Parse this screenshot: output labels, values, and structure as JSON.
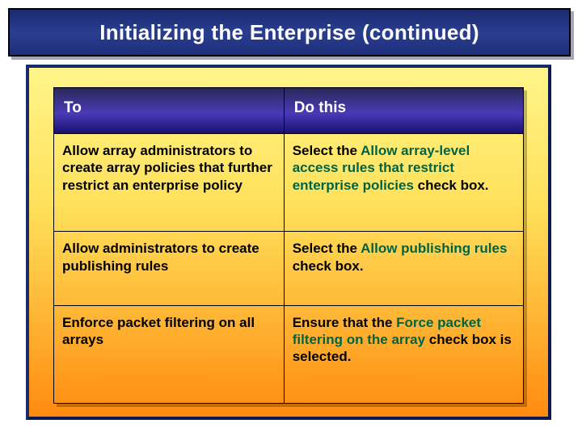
{
  "title": "Initializing the Enterprise (continued)",
  "headers": {
    "c1": "To",
    "c2": "Do this"
  },
  "rows": [
    {
      "to": "Allow array administrators to create array policies that further restrict an enterprise policy",
      "do_pre": "Select the ",
      "do_green": "Allow array-level access rules that restrict enterprise policies",
      "do_post": " check box."
    },
    {
      "to": "Allow administrators to create publishing rules",
      "do_pre": "Select the ",
      "do_green": "Allow publishing rules",
      "do_post": " check box."
    },
    {
      "to": "Enforce packet filtering on all arrays",
      "do_pre": "Ensure that the ",
      "do_green": "Force packet filtering on the array",
      "do_post": " check box is selected."
    }
  ]
}
